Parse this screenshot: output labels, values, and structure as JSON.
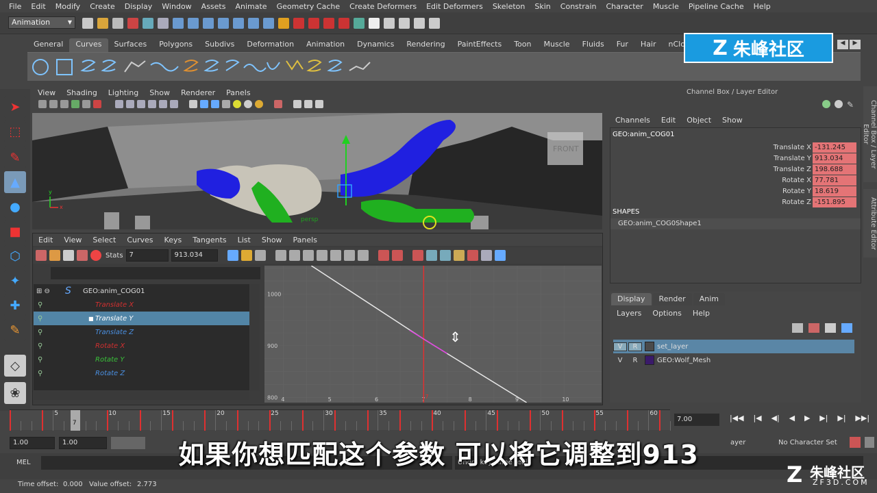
{
  "menubar": [
    "File",
    "Edit",
    "Modify",
    "Create",
    "Display",
    "Window",
    "Assets",
    "Animate",
    "Geometry Cache",
    "Create Deformers",
    "Edit Deformers",
    "Skeleton",
    "Skin",
    "Constrain",
    "Character",
    "Muscle",
    "Pipeline Cache",
    "Help"
  ],
  "mode_selector": "Animation",
  "shelf_tabs": [
    "General",
    "Curves",
    "Surfaces",
    "Polygons",
    "Subdivs",
    "Deformation",
    "Animation",
    "Dynamics",
    "Rendering",
    "PaintEffects",
    "Toon",
    "Muscle",
    "Fluids",
    "Fur",
    "Hair",
    "nCloth"
  ],
  "viewport": {
    "menu": [
      "View",
      "Shading",
      "Lighting",
      "Show",
      "Renderer",
      "Panels"
    ],
    "view_cube_label": "FRONT",
    "persp_label": "persp"
  },
  "graph_editor": {
    "menu": [
      "Edit",
      "View",
      "Select",
      "Curves",
      "Keys",
      "Tangents",
      "List",
      "Show",
      "Panels"
    ],
    "stats_label": "Stats",
    "stats_frame": "7",
    "stats_value": "913.034",
    "outliner_root": "GEO:anim_COG01",
    "channels": [
      {
        "name": "Translate X",
        "color": "#d03030",
        "selected": false
      },
      {
        "name": "Translate Y",
        "color": "#ffffff",
        "selected": true
      },
      {
        "name": "Translate Z",
        "color": "#4a8fe0",
        "selected": false
      },
      {
        "name": "Rotate X",
        "color": "#d03030",
        "selected": false
      },
      {
        "name": "Rotate Y",
        "color": "#3ac23a",
        "selected": false
      },
      {
        "name": "Rotate Z",
        "color": "#4a8fe0",
        "selected": false
      }
    ],
    "y_ticks": [
      "1000",
      "900",
      "800"
    ],
    "x_ticks": [
      "4",
      "5",
      "6",
      "7",
      "8",
      "9",
      "10"
    ],
    "current_frame_label": "7"
  },
  "channel_box": {
    "header": "Channel Box / Layer Editor",
    "menu": [
      "Channels",
      "Edit",
      "Object",
      "Show"
    ],
    "object": "GEO:anim_COG01",
    "attributes": [
      {
        "label": "Translate X",
        "value": "-131.245"
      },
      {
        "label": "Translate Y",
        "value": "913.034"
      },
      {
        "label": "Translate Z",
        "value": "198.688"
      },
      {
        "label": "Rotate X",
        "value": "77.781"
      },
      {
        "label": "Rotate Y",
        "value": "18.619"
      },
      {
        "label": "Rotate Z",
        "value": "-151.895"
      }
    ],
    "shapes_label": "SHAPES",
    "shape_name": "GEO:anim_COG0Shape1"
  },
  "layer_editor": {
    "tabs": [
      "Display",
      "Render",
      "Anim"
    ],
    "menu": [
      "Layers",
      "Options",
      "Help"
    ],
    "layers": [
      {
        "v": "V",
        "r": "R",
        "name": "set_layer",
        "color": "#4a4a4a",
        "selected": true
      },
      {
        "v": "V",
        "r": "R",
        "name": "GEO:Wolf_Mesh",
        "color": "#3a1a6a",
        "selected": false
      }
    ]
  },
  "side_tabs": [
    "Channel Box / Layer Editor",
    "Attribute Editor"
  ],
  "time_slider": {
    "numbers": [
      "5",
      "10",
      "15",
      "20",
      "25",
      "30",
      "35",
      "40",
      "45",
      "50",
      "55",
      "60"
    ],
    "current_frame": "7",
    "current_field": "7.00"
  },
  "range_slider": {
    "start": "1.00",
    "start2": "1.00",
    "layer_label": "ayer",
    "character_set": "No Character Set"
  },
  "command_line": {
    "label": "MEL",
    "feedback": "Undo: keyframe -edit"
  },
  "help_line": {
    "time_offset_label": "Time offset:",
    "time_offset_value": "0.000",
    "value_offset_label": "Value offset:",
    "value_offset_value": "2.773"
  },
  "subtitle": "如果你想匹配这个参数 可以将它调整到913",
  "brand_top": "朱峰社区",
  "watermark": {
    "name": "朱峰社区",
    "url": "ZF3D.COM"
  }
}
